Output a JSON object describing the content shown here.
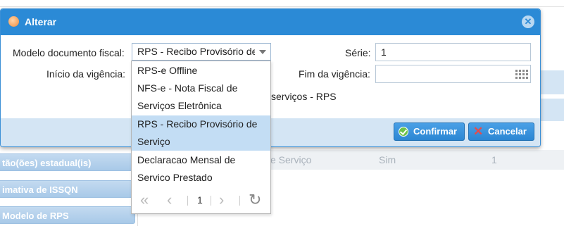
{
  "background": {
    "row": {
      "col1": "e Serviço",
      "col2": "Sim",
      "col3": "1"
    },
    "side_buttons": [
      "tão(ões) estadual(is)",
      "imativa de ISSQN",
      "Modelo de RPS"
    ]
  },
  "dialog": {
    "title": "Alterar",
    "close_symbol": "✕",
    "fields": {
      "modelo_label": "Modelo documento fiscal:",
      "modelo_value": "RPS - Recibo Provisório de Serviços",
      "serie_label": "Série:",
      "serie_value": "1",
      "inicio_label": "Início da vigência:",
      "fim_label": "Fim da vigência:",
      "fim_value": "",
      "description_partial": "serviços - RPS"
    },
    "buttons": {
      "confirm": "Confirmar",
      "cancel": "Cancelar"
    },
    "colors": {
      "titlebar": "#2b8ad6",
      "footer": "#d4e5f4",
      "selected_option": "#c3ddf4"
    }
  },
  "dropdown": {
    "options": [
      "RPS-e Offline",
      "NFS-e - Nota Fiscal de Serviços Eletrônica",
      "RPS - Recibo Provisório de Serviço",
      "Declaracao Mensal de Servico Prestado"
    ],
    "selected_index": 2,
    "pager": {
      "first": "«",
      "prev": "‹",
      "page": "1",
      "next": "›",
      "refresh": "↻"
    }
  }
}
